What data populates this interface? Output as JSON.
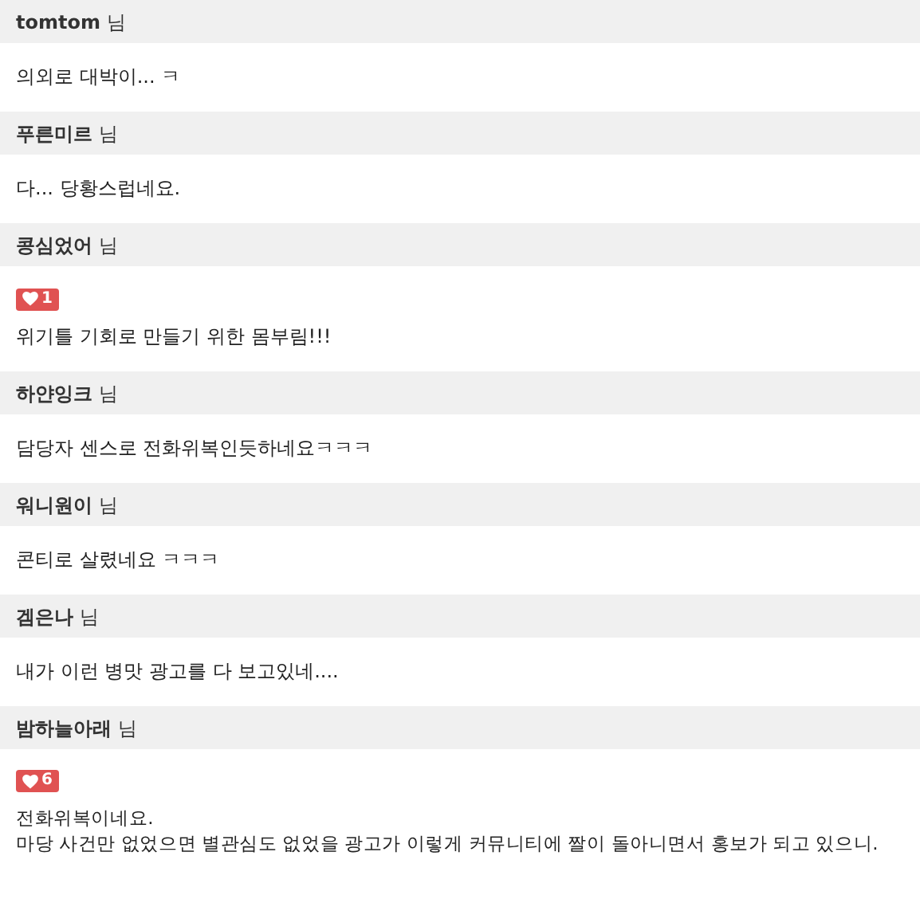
{
  "comments": [
    {
      "author": "tomtom",
      "suffix": "님",
      "lines": [
        "의외로 대박이... ㅋ"
      ]
    },
    {
      "author": "푸른미르",
      "suffix": "님",
      "lines": [
        "다... 당황스럽네요."
      ]
    },
    {
      "author": "콩심었어",
      "suffix": "님",
      "likes": "1",
      "lines": [
        "위기틀 기회로 만들기 위한 몸부림!!!"
      ]
    },
    {
      "author": "하얀잉크",
      "suffix": "님",
      "lines": [
        "담당자 센스로 전화위복인듯하네요ㅋㅋㅋ"
      ]
    },
    {
      "author": "워니원이",
      "suffix": "님",
      "lines": [
        "콘티로 살렸네요 ㅋㅋㅋ"
      ]
    },
    {
      "author": "겜은나",
      "suffix": "님",
      "lines": [
        "내가 이런 병맛 광고를 다 보고있네...."
      ]
    },
    {
      "author": "밤하늘아래",
      "suffix": "님",
      "likes": "6",
      "lines": [
        "전화위복이네요.",
        "마당 사건만 없었으면 별관심도 없었을 광고가 이렇게 커뮤니티에 짤이 돌아니면서 홍보가 되고 있으니."
      ]
    }
  ]
}
